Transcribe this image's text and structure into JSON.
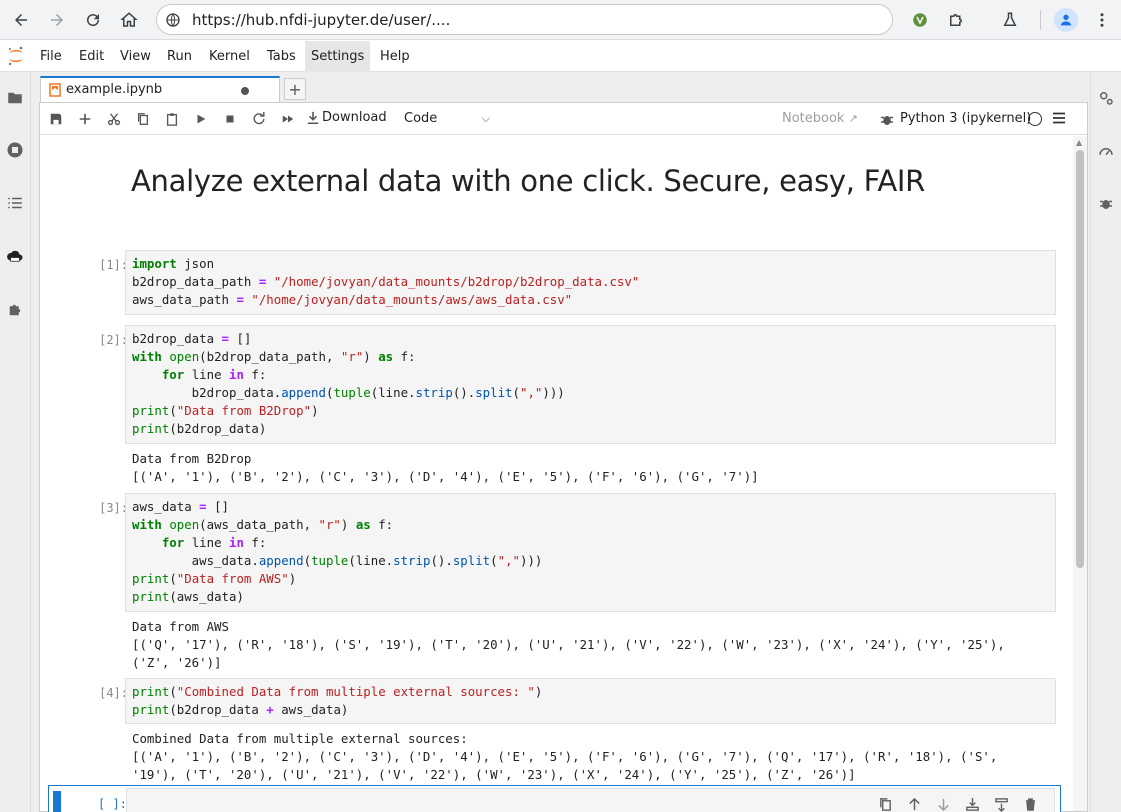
{
  "browser": {
    "url": "https://hub.nfdi-jupyter.de/user/...."
  },
  "menubar": {
    "items": [
      "File",
      "Edit",
      "View",
      "Run",
      "Kernel",
      "Tabs",
      "Settings",
      "Help"
    ],
    "active": "Settings"
  },
  "tab": {
    "label": "example.ipynb",
    "add_label": "+"
  },
  "toolbar": {
    "download_label": "Download",
    "cell_type": "Code",
    "notebook_label": "Notebook",
    "kernel_label": "Python 3 (ipykernel)"
  },
  "notebook": {
    "heading": "Analyze external data with one click. Secure, easy, FAIR",
    "cells": [
      {
        "prompt": "[1]:",
        "lines": [
          "import json",
          "b2drop_data_path = \"/home/jovyan/data_mounts/b2drop/b2drop_data.csv\"",
          "aws_data_path = \"/home/jovyan/data_mounts/aws/aws_data.csv\""
        ],
        "output": []
      },
      {
        "prompt": "[2]:",
        "lines": [
          "b2drop_data = []",
          "with open(b2drop_data_path, \"r\") as f:",
          "    for line in f:",
          "        b2drop_data.append(tuple(line.strip().split(\",\")))",
          "print(\"Data from B2Drop\")",
          "print(b2drop_data)"
        ],
        "output": [
          "Data from B2Drop",
          "[('A', '1'), ('B', '2'), ('C', '3'), ('D', '4'), ('E', '5'), ('F', '6'), ('G', '7')]"
        ]
      },
      {
        "prompt": "[3]:",
        "lines": [
          "aws_data = []",
          "with open(aws_data_path, \"r\") as f:",
          "    for line in f:",
          "        aws_data.append(tuple(line.strip().split(\",\")))",
          "print(\"Data from AWS\")",
          "print(aws_data)"
        ],
        "output": [
          "Data from AWS",
          "[('Q', '17'), ('R', '18'), ('S', '19'), ('T', '20'), ('U', '21'), ('V', '22'), ('W', '23'), ('X', '24'), ('Y', '25'),",
          "('Z', '26')]"
        ]
      },
      {
        "prompt": "[4]:",
        "lines": [
          "print(\"Combined Data from multiple external sources: \")",
          "print(b2drop_data + aws_data)"
        ],
        "output": [
          "Combined Data from multiple external sources:",
          "[('A', '1'), ('B', '2'), ('C', '3'), ('D', '4'), ('E', '5'), ('F', '6'), ('G', '7'), ('Q', '17'), ('R', '18'), ('S',",
          "'19'), ('T', '20'), ('U', '21'), ('V', '22'), ('W', '23'), ('X', '24'), ('Y', '25'), ('Z', '26')]"
        ]
      }
    ],
    "active_prompt": "[ ]:"
  },
  "colors": {
    "accent": "#1976d2",
    "keyword": "#008000",
    "string": "#ba2121"
  }
}
